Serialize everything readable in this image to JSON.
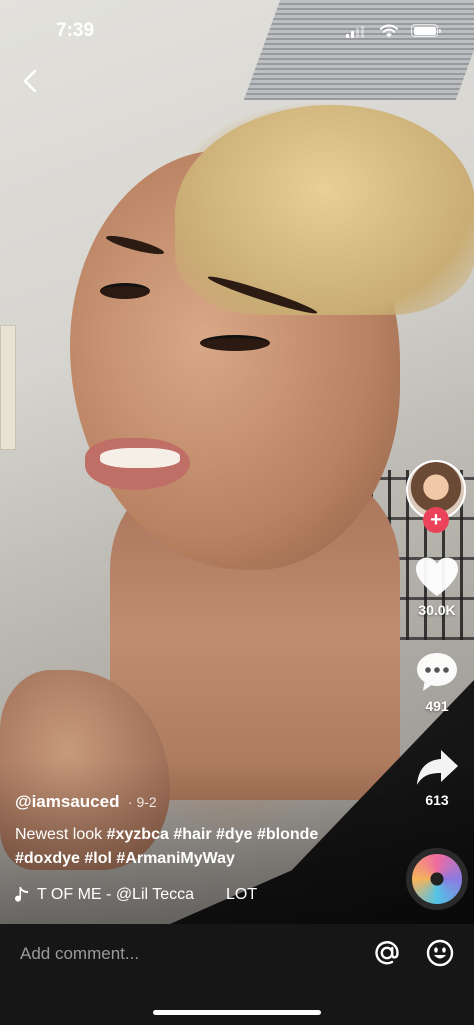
{
  "status_bar": {
    "time": "7:39"
  },
  "profile": {
    "follow_symbol": "+"
  },
  "actions": {
    "likes": "30.0K",
    "comments": "491",
    "shares": "613"
  },
  "caption": {
    "username": "@iamsauced",
    "date": "· 9-2",
    "text_plain": "Newest look",
    "hashtags_line1": [
      "#xyzbca",
      "#hair",
      "#dye",
      "#blonde"
    ],
    "hashtags_line2": [
      "#doxdye",
      "#lol",
      "#ArmaniMyWay"
    ]
  },
  "music": {
    "text": "T OF ME - @Lil Tecca",
    "text2": "LOT"
  },
  "comment_bar": {
    "placeholder": "Add comment..."
  },
  "colors": {
    "follow_accent": "#ea4359",
    "comment_bar_bg": "#161616"
  }
}
